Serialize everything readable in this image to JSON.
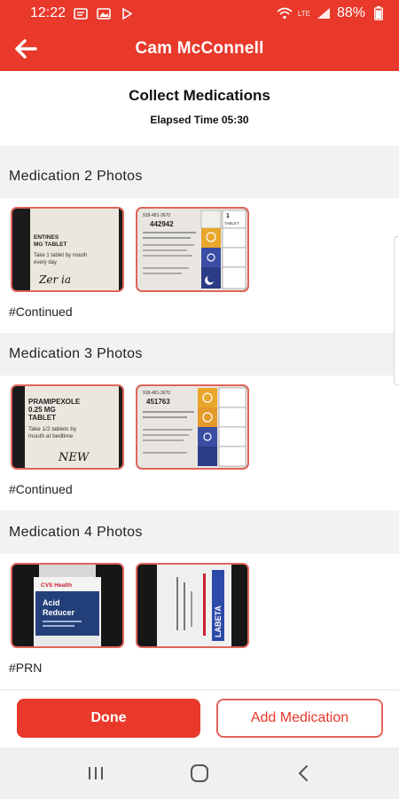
{
  "status_bar": {
    "time": "12:22",
    "battery": "88%",
    "network_label": "LTE",
    "icons": [
      "message-icon",
      "image-icon",
      "play-icon",
      "wifi-icon",
      "signal-icon",
      "battery-icon"
    ]
  },
  "app_bar": {
    "title": "Cam McConnell",
    "back_icon": "arrow-left-icon"
  },
  "header": {
    "title": "Collect Medications",
    "elapsed": "Elapsed Time 05:30"
  },
  "sections": [
    {
      "title": "Medication 2 Photos",
      "tag": "#Continued",
      "photos": [
        {
          "label_lines": [
            "ENTINES",
            "MG TABLET",
            "Take 1 tablet by mouth",
            "every day"
          ],
          "handwriting": "Zer ia"
        },
        {
          "label_lines": [
            "918-481-3670",
            "442942",
            "1",
            "TABLET"
          ]
        }
      ]
    },
    {
      "title": "Medication 3 Photos",
      "tag": "#Continued",
      "photos": [
        {
          "label_lines": [
            "PRAMIPEXOLE",
            "0.25 MG",
            "TABLET",
            "Take 1/2 tablets by",
            "mouth at bedtime"
          ],
          "handwriting": "NEW"
        },
        {
          "label_lines": [
            "918-481-3670",
            "451763"
          ]
        }
      ]
    },
    {
      "title": "Medication 4 Photos",
      "tag": "#PRN",
      "photos": [
        {
          "label_lines": [
            "CVS Health",
            "Acid",
            "Reducer"
          ]
        },
        {
          "label_lines": [
            "LABETA"
          ]
        }
      ]
    }
  ],
  "buttons": {
    "done": "Done",
    "add_medication": "Add Medication"
  },
  "nav": {
    "recents": "recents-icon",
    "home": "home-icon",
    "back": "back-chevron-icon"
  },
  "colors": {
    "accent": "#e8392b",
    "photo_border": "#e0655b",
    "background": "#f2f2f2"
  }
}
